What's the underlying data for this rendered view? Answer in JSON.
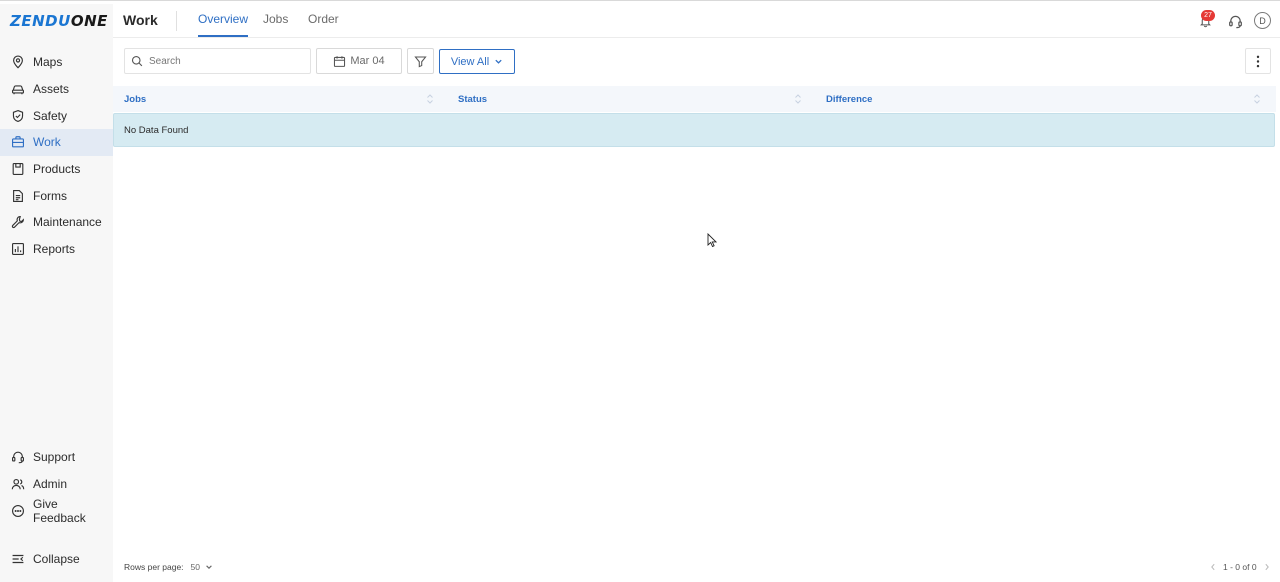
{
  "app": {
    "logo_part1": "ZENDU",
    "logo_part2": "ONE",
    "brand_color": "#1b76d2",
    "accent_color": "#2f6fc4"
  },
  "sidebar": {
    "items": [
      {
        "label": "Maps",
        "icon": "map-pin-icon"
      },
      {
        "label": "Assets",
        "icon": "car-icon"
      },
      {
        "label": "Safety",
        "icon": "shield-icon"
      },
      {
        "label": "Work",
        "icon": "briefcase-icon",
        "active": true
      },
      {
        "label": "Products",
        "icon": "box-icon"
      },
      {
        "label": "Forms",
        "icon": "document-icon"
      },
      {
        "label": "Maintenance",
        "icon": "wrench-icon"
      },
      {
        "label": "Reports",
        "icon": "bar-chart-icon"
      }
    ],
    "bottom_items": [
      {
        "label": "Support",
        "icon": "headset-icon"
      },
      {
        "label": "Admin",
        "icon": "users-icon"
      },
      {
        "label": "Give Feedback",
        "icon": "chat-icon"
      }
    ],
    "collapse_label": "Collapse"
  },
  "header": {
    "title": "Work",
    "tabs": [
      {
        "label": "Overview",
        "active": true
      },
      {
        "label": "Jobs"
      },
      {
        "label": "Order"
      }
    ],
    "notification_count": "27",
    "avatar_initial": "D"
  },
  "toolbar": {
    "search_placeholder": "Search",
    "date_label": "Mar 04",
    "view_label": "View All"
  },
  "table": {
    "columns": [
      "Jobs",
      "Status",
      "Difference"
    ],
    "empty_message": "No Data Found"
  },
  "footer": {
    "rows_per_page_label": "Rows per page:",
    "rows_per_page_value": "50",
    "range_text": "1 - 0 of 0"
  }
}
